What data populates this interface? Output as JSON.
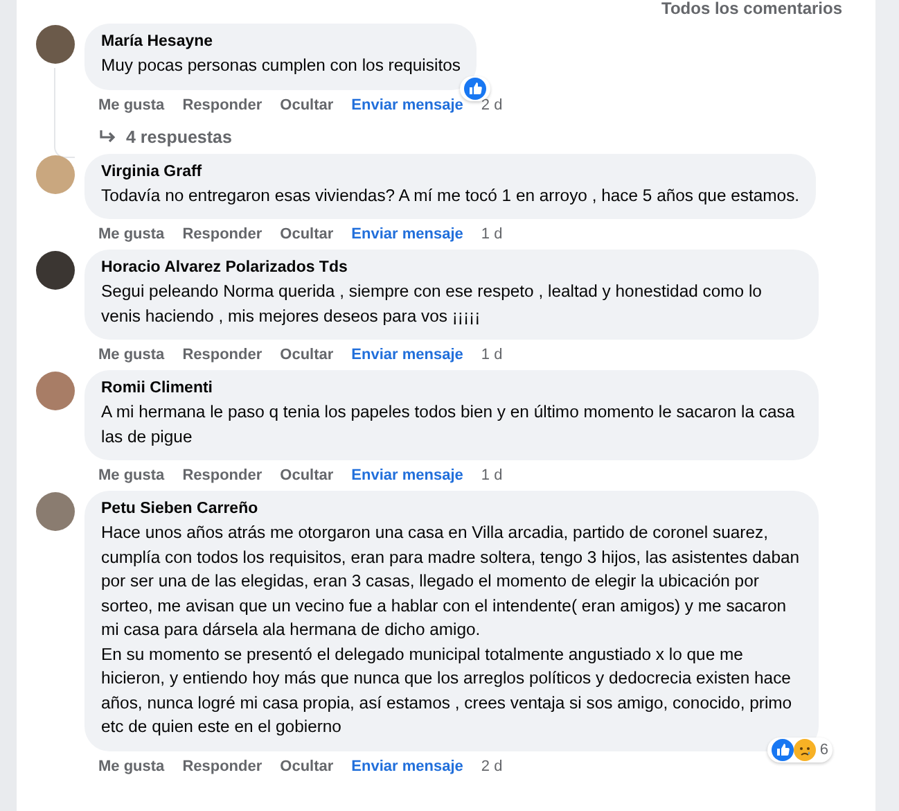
{
  "header_link": "Todos los comentarios",
  "comments": [
    {
      "author": "María Hesayne",
      "text": "Muy pocas personas cumplen con los requisitos",
      "actions": [
        "Me gusta",
        "Responder",
        "Ocultar"
      ],
      "message_link": "Enviar mensaje",
      "time": "2 d",
      "reactions": [
        {
          "kind": "like"
        }
      ],
      "replies": "4 respuestas"
    },
    {
      "author": "Virginia Graff",
      "text": "Todavía no entregaron esas viviendas? A mí me tocó 1 en arroyo , hace 5 años que estamos.",
      "actions": [
        "Me gusta",
        "Responder",
        "Ocultar"
      ],
      "message_link": "Enviar mensaje",
      "time": "1 d"
    },
    {
      "author": "Horacio Alvarez Polarizados Tds",
      "text": "Segui peleando Norma querida , siempre con ese respeto , lealtad y honestidad como lo venis haciendo , mis mejores deseos para vos ¡¡¡¡¡",
      "actions": [
        "Me gusta",
        "Responder",
        "Ocultar"
      ],
      "message_link": "Enviar mensaje",
      "time": "1 d"
    },
    {
      "author": "Romii Climenti",
      "text": "A mi hermana le paso q tenia los papeles todos bien y en último momento le sacaron la casa las de pigue",
      "actions": [
        "Me gusta",
        "Responder",
        "Ocultar"
      ],
      "message_link": "Enviar mensaje",
      "time": "1 d"
    },
    {
      "author": "Petu Sieben Carreño",
      "text": "Hace unos años atrás me otorgaron una casa en Villa arcadia, partido de coronel suarez, cumplía con todos los requisitos, eran para madre soltera, tengo 3 hijos, las asistentes daban por ser una de las elegidas, eran 3 casas, llegado el momento de elegir la ubicación por sorteo, me avisan que un vecino fue a hablar con el intendente( eran amigos) y me sacaron mi casa para dársela ala hermana de dicho amigo.\nEn su momento se presentó el delegado municipal totalmente angustiado x lo que me hicieron, y entiendo hoy más que nunca que los arreglos políticos y dedocrecia existen hace años, nunca logré mi casa propia, así estamos , crees ventaja si sos amigo, conocido, primo etc de quien este en el gobierno",
      "actions": [
        "Me gusta",
        "Responder",
        "Ocultar"
      ],
      "message_link": "Enviar mensaje",
      "time": "2 d",
      "reactions": [
        {
          "kind": "like"
        },
        {
          "kind": "sad"
        }
      ],
      "reaction_count": "6"
    }
  ]
}
